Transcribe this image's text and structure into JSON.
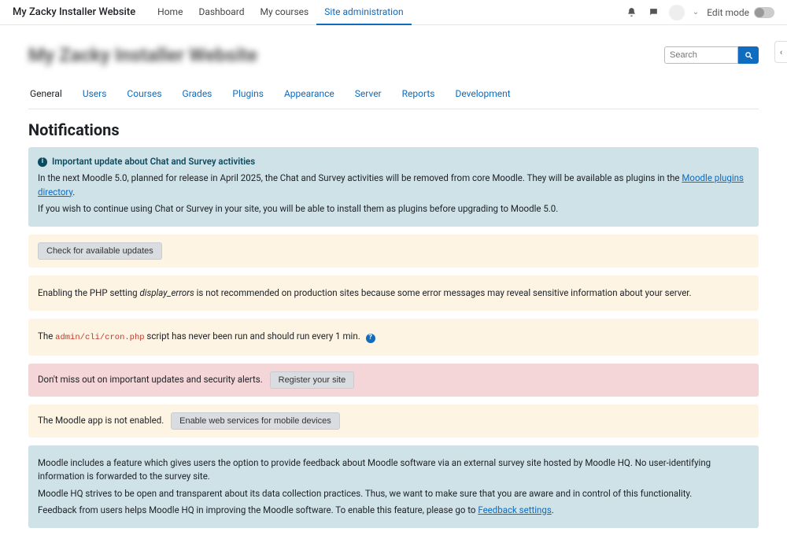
{
  "brand": "My Zacky Installer Website",
  "topnav": [
    {
      "label": "Home"
    },
    {
      "label": "Dashboard"
    },
    {
      "label": "My courses"
    },
    {
      "label": "Site administration",
      "active": true
    }
  ],
  "editmode_label": "Edit mode",
  "blur_title": "My Zacky Installer Website",
  "search": {
    "placeholder": "Search"
  },
  "admin_tabs": [
    {
      "label": "General",
      "active": true
    },
    {
      "label": "Users"
    },
    {
      "label": "Courses"
    },
    {
      "label": "Grades"
    },
    {
      "label": "Plugins"
    },
    {
      "label": "Appearance"
    },
    {
      "label": "Server"
    },
    {
      "label": "Reports"
    },
    {
      "label": "Development"
    }
  ],
  "page_heading": "Notifications",
  "panel_update": {
    "title": "Important update about Chat and Survey activities",
    "p1a": "In the next Moodle 5.0, planned for release in April 2025, the Chat and Survey activities will be removed from core Moodle. They will be available as plugins in the ",
    "link1": "Moodle plugins directory",
    "p1b": ".",
    "p2": "If you wish to continue using Chat or Survey in your site, you will be able to install them as plugins before upgrading to Moodle 5.0."
  },
  "panel_check": {
    "button": "Check for available updates"
  },
  "panel_display_errors": {
    "pre": "Enabling the PHP setting ",
    "em": "display_errors",
    "post": " is not recommended on production sites because some error messages may reveal sensitive information about your server."
  },
  "panel_cron": {
    "pre": "The ",
    "code": "admin/cli/cron.php",
    "post": " script has never been run and should run every 1 min."
  },
  "panel_register": {
    "text": "Don't miss out on important updates and security alerts.",
    "button": "Register your site"
  },
  "panel_app": {
    "text": "The Moodle app is not enabled.",
    "button": "Enable web services for mobile devices"
  },
  "panel_feedback": {
    "p1": "Moodle includes a feature which gives users the option to provide feedback about Moodle software via an external survey site hosted by Moodle HQ. No user-identifying information is forwarded to the survey site.",
    "p2": "Moodle HQ strives to be open and transparent about its data collection practices. Thus, we want to make sure that you are aware and in control of this functionality.",
    "p3a": "Feedback from users helps Moodle HQ in improving the Moodle software. To enable this feature, please go to ",
    "link": "Feedback settings",
    "p3b": "."
  }
}
